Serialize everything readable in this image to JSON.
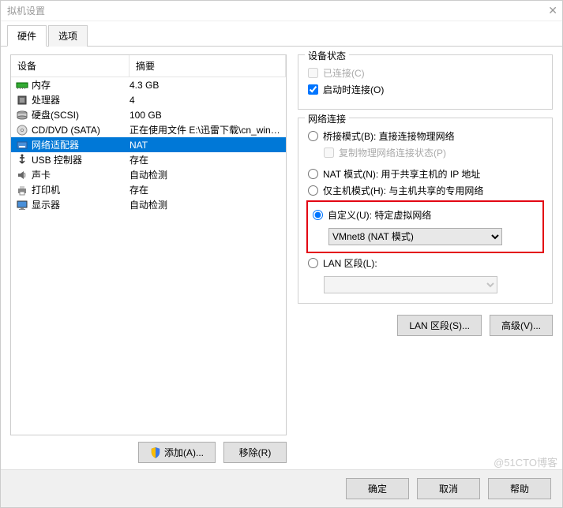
{
  "titlebar": {
    "title": "拟机设置"
  },
  "tabs": {
    "hardware": "硬件",
    "options": "选项"
  },
  "listHeader": {
    "device": "设备",
    "summary": "摘要"
  },
  "devices": [
    {
      "name": "内存",
      "summary": "4.3 GB",
      "icon": "memory"
    },
    {
      "name": "处理器",
      "summary": "4",
      "icon": "cpu"
    },
    {
      "name": "硬盘(SCSI)",
      "summary": "100 GB",
      "icon": "hdd"
    },
    {
      "name": "CD/DVD (SATA)",
      "summary": "正在使用文件 E:\\迅雷下载\\cn_wind...",
      "icon": "cd"
    },
    {
      "name": "网络适配器",
      "summary": "NAT",
      "icon": "nic"
    },
    {
      "name": "USB 控制器",
      "summary": "存在",
      "icon": "usb"
    },
    {
      "name": "声卡",
      "summary": "自动检测",
      "icon": "sound"
    },
    {
      "name": "打印机",
      "summary": "存在",
      "icon": "printer"
    },
    {
      "name": "显示器",
      "summary": "自动检测",
      "icon": "display"
    }
  ],
  "leftButtons": {
    "add": "添加(A)...",
    "remove": "移除(R)"
  },
  "deviceStatus": {
    "title": "设备状态",
    "connected": "已连接(C)",
    "connectAtPowerOn": "启动时连接(O)"
  },
  "network": {
    "title": "网络连接",
    "bridged": "桥接模式(B): 直接连接物理网络",
    "replicate": "复制物理网络连接状态(P)",
    "nat": "NAT 模式(N): 用于共享主机的 IP 地址",
    "hostOnly": "仅主机模式(H): 与主机共享的专用网络",
    "custom": "自定义(U): 特定虚拟网络",
    "customValue": "VMnet8 (NAT 模式)",
    "lan": "LAN 区段(L):"
  },
  "rightButtons": {
    "lanSegments": "LAN 区段(S)...",
    "advanced": "高级(V)..."
  },
  "footer": {
    "ok": "确定",
    "cancel": "取消",
    "help": "帮助"
  },
  "watermark": "@51CTO博客"
}
